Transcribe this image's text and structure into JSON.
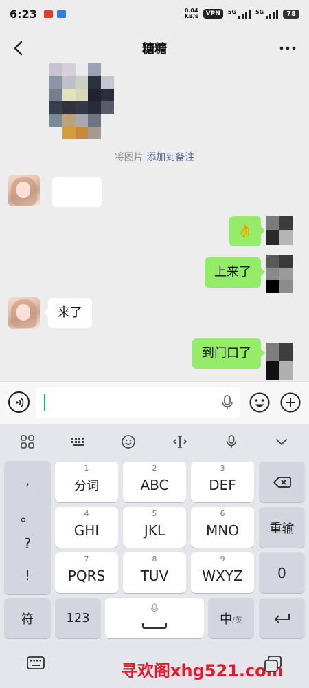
{
  "status_bar": {
    "time": "6:23",
    "net_speed_value": "0.04",
    "net_speed_unit": "KB/s",
    "vpn": "VPN",
    "sim1": "5G",
    "sim2": "5G",
    "battery": "78"
  },
  "header": {
    "title": "糖糖"
  },
  "messages": {
    "photo_caption_prefix": "将图片 ",
    "photo_caption_link": "添加到备注",
    "out_emoji": "👌",
    "out_text_1": "上来了",
    "in_text_1": "来了",
    "out_text_2": "到门口了"
  },
  "input_bar": {
    "placeholder": ""
  },
  "keyboard": {
    "punct": [
      ",",
      "。",
      "?",
      "!"
    ],
    "rows": [
      [
        {
          "num": "1",
          "label": "分词"
        },
        {
          "num": "2",
          "label": "ABC"
        },
        {
          "num": "3",
          "label": "DEF"
        }
      ],
      [
        {
          "num": "4",
          "label": "GHI"
        },
        {
          "num": "5",
          "label": "JKL"
        },
        {
          "num": "6",
          "label": "MNO"
        }
      ],
      [
        {
          "num": "7",
          "label": "PQRS"
        },
        {
          "num": "8",
          "label": "TUV"
        },
        {
          "num": "9",
          "label": "WXYZ"
        }
      ]
    ],
    "reinput": "重输",
    "zero": "0",
    "symbol": "符",
    "num_mode": "123",
    "lang_main": "中",
    "lang_alt": "/英"
  },
  "watermark": "寻欢阁xhg521.com",
  "colors": {
    "bubble_out": "#95ec69",
    "link": "#576b95",
    "caret": "#07c160",
    "watermark": "#e8172a"
  }
}
